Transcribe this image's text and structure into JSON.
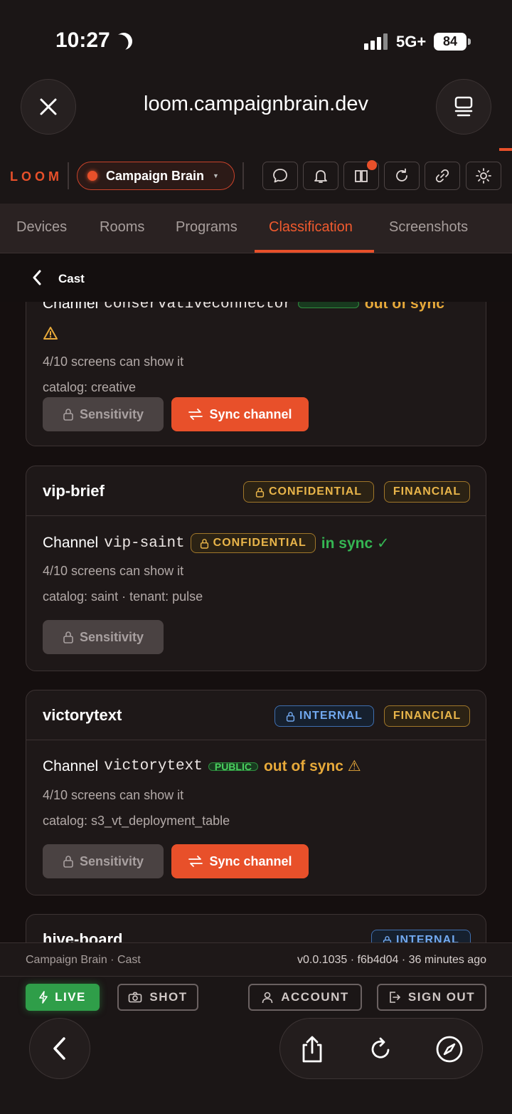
{
  "status": {
    "time": "10:27",
    "network": "5G+",
    "battery": "84"
  },
  "browser": {
    "url": "loom.campaignbrain.dev"
  },
  "header": {
    "logo": "LOOM",
    "workspace": "Campaign Brain"
  },
  "tabs": [
    {
      "label": "Devices"
    },
    {
      "label": "Rooms"
    },
    {
      "label": "Programs"
    },
    {
      "label": "Classification"
    },
    {
      "label": "Screenshots"
    }
  ],
  "subheader": {
    "title": "Cast"
  },
  "cards": [
    {
      "title": "",
      "channel_prefix": "Channel",
      "channel": "conservativeconnector",
      "sync": "out of sync",
      "screens": "4/10 screens can show it",
      "catalog": "catalog: creative",
      "sensitivity_label": "Sensitivity",
      "sync_label": "Sync channel"
    },
    {
      "title": "vip-brief",
      "badges": [
        "CONFIDENTIAL",
        "FINANCIAL"
      ],
      "channel_prefix": "Channel",
      "channel": "vip-saint",
      "channel_badge": "CONFIDENTIAL",
      "sync": "in sync ✓",
      "screens": "4/10 screens can show it",
      "catalog": "catalog: saint · tenant: pulse",
      "sensitivity_label": "Sensitivity"
    },
    {
      "title": "victorytext",
      "badges": [
        "INTERNAL",
        "FINANCIAL"
      ],
      "channel_prefix": "Channel",
      "channel": "victorytext",
      "channel_badge": "PUBLIC",
      "sync": "out of sync ⚠",
      "screens": "4/10 screens can show it",
      "catalog": "catalog: s3_vt_deployment_table",
      "sensitivity_label": "Sensitivity",
      "sync_label": "Sync channel"
    },
    {
      "title": "hive-board",
      "badges": [
        "INTERNAL"
      ]
    }
  ],
  "footer": {
    "left": "Campaign Brain · Cast",
    "right": "v0.0.1035 · f6b4d04 · 36 minutes ago"
  },
  "actions": {
    "live": "LIVE",
    "shot": "SHOT",
    "account": "ACCOUNT",
    "signout": "SIGN OUT"
  },
  "colors": {
    "accent": "#e8502a",
    "success": "#35b653",
    "warning": "#e7a93a",
    "info": "#72a9f0"
  }
}
